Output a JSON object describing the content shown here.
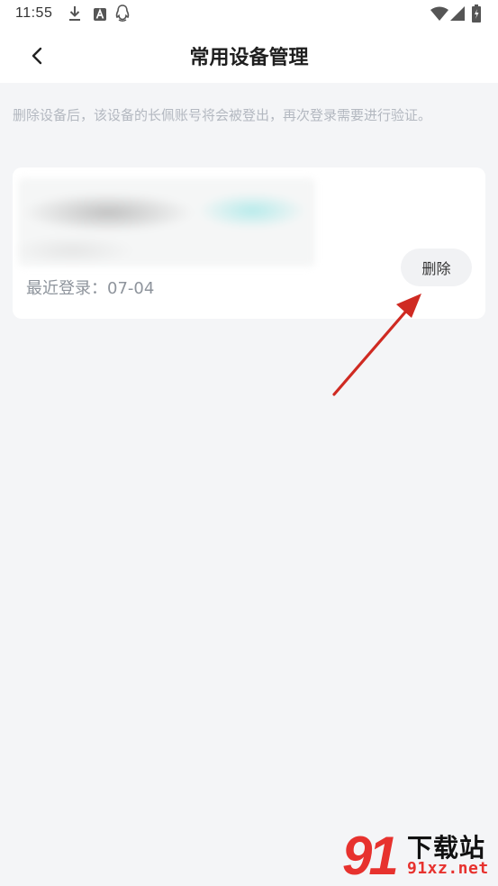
{
  "status_bar": {
    "time": "11:55",
    "icons": [
      "download-icon",
      "a-notification-icon",
      "qq-icon",
      "wifi-icon",
      "signal-icon",
      "battery-icon"
    ]
  },
  "header": {
    "title": "常用设备管理",
    "back_icon": "chevron-left-icon"
  },
  "notice": "删除设备后，该设备的长佩账号将会被登出，再次登录需要进行验证。",
  "devices": [
    {
      "last_login": "最近登录：07-04",
      "delete_label": "删除"
    }
  ],
  "watermark": {
    "logo": "91",
    "site_name": "下载站",
    "url": "91xz.net"
  },
  "colors": {
    "page_background": "#f4f5f7",
    "card_background": "#ffffff",
    "notice_text": "#b3b8c0",
    "delete_button_bg": "#f1f2f4",
    "annotation_arrow": "#cf2a22",
    "watermark_red": "#e7322e"
  }
}
